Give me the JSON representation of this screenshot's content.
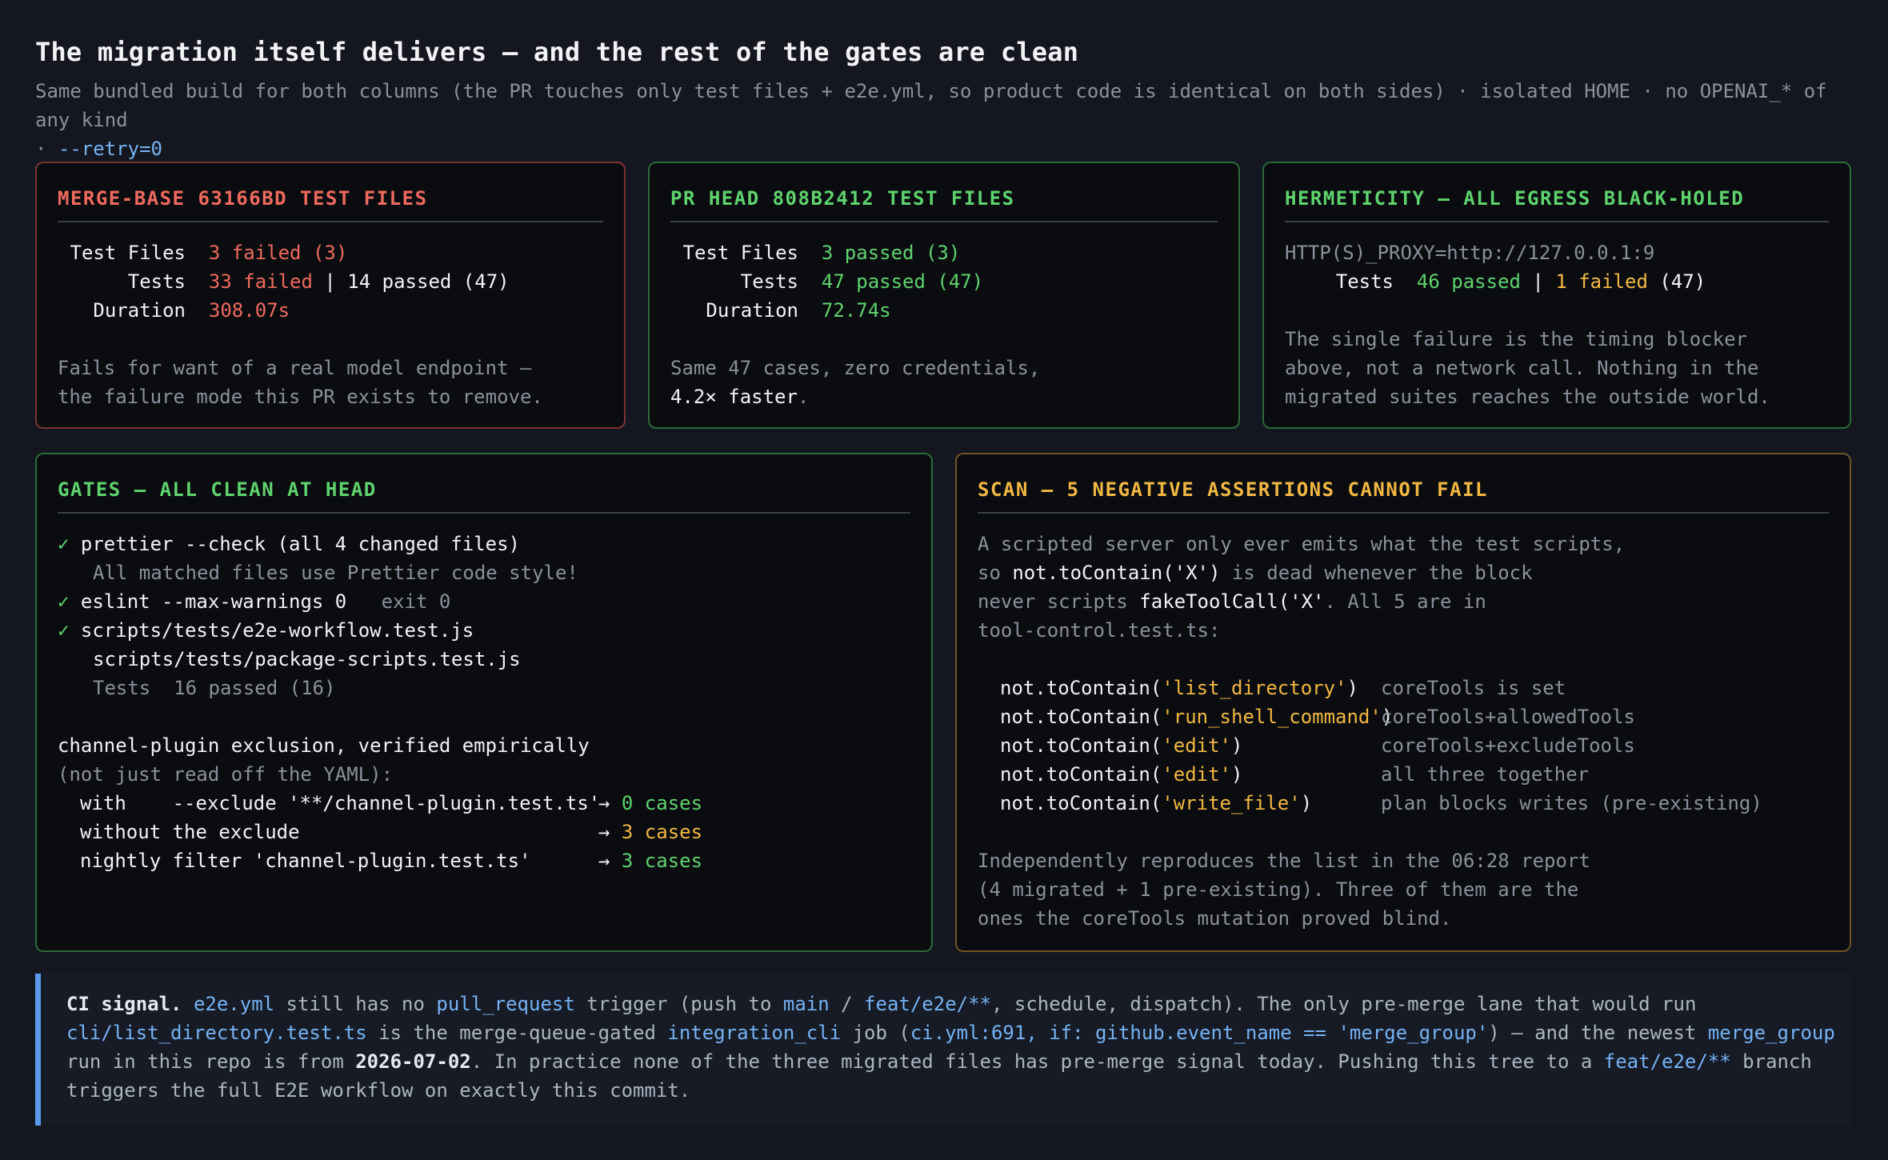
{
  "title": "The migration itself delivers — and the rest of the gates are clean",
  "subtitle": {
    "text": "Same bundled build for both columns (the PR touches only test files + e2e.yml, so product code is identical on both sides) · isolated HOME · no OPENAI_* of any kind",
    "text2_prefix": "· ",
    "retry": "--retry=0"
  },
  "merge_base": {
    "heading": "MERGE-BASE 63166BD TEST FILES",
    "k1": "Test Files",
    "v1": "3 failed (3)",
    "k2": "Tests",
    "v2a": "33 failed",
    "v2b": " | 14 passed (47)",
    "k3": "Duration",
    "v3": "308.07s",
    "note1": "Fails for want of a real model endpoint —",
    "note2": "the failure mode this PR exists to remove."
  },
  "pr_head": {
    "heading": "PR HEAD 808B2412 TEST FILES",
    "k1": "Test Files",
    "v1": "3 passed (3)",
    "k2": "Tests",
    "v2": "47 passed (47)",
    "k3": "Duration",
    "v3": "72.74s",
    "note1": "Same 47 cases, zero credentials,",
    "note2a": "4.2× faster",
    "note2b": "."
  },
  "hermeticity": {
    "heading": "HERMETICITY — ALL EGRESS BLACK-HOLED",
    "proxy": "HTTP(S)_PROXY=http://127.0.0.1:9",
    "k": "Tests",
    "va": "46 passed",
    "vb": " | ",
    "vc": "1 failed",
    "vd": " (47)",
    "note1": "The single failure is the timing blocker",
    "note2": "above, not a network call. Nothing in the",
    "note3": "migrated suites reaches the outside world."
  },
  "gates": {
    "heading": "GATES — ALL CLEAN AT HEAD",
    "check": "✓",
    "l1": "prettier --check (all 4 changed files)",
    "l2": "All matched files use Prettier code style!",
    "l3": "eslint --max-warnings 0",
    "l3b": "exit 0",
    "l4": "scripts/tests/e2e-workflow.test.js",
    "l5": "scripts/tests/package-scripts.test.js",
    "l6": "Tests  16 passed (16)",
    "e1": "channel-plugin exclusion, verified empirically",
    "e2": "(not just read off the YAML):",
    "r1": "with    --exclude '**/channel-plugin.test.ts'",
    "r1v": "0 cases",
    "r2": "without the exclude",
    "r2v": "3 cases",
    "r3": "nightly filter 'channel-plugin.test.ts'",
    "r3v": "3 cases",
    "arrow": "→"
  },
  "scan": {
    "heading": "SCAN — 5 NEGATIVE ASSERTIONS CANNOT FAIL",
    "p1": "A scripted server only ever emits what the test scripts,",
    "p2a": "so ",
    "p2b": "not.toContain('X')",
    "p2c": " is dead whenever the block",
    "p3a": "never scripts ",
    "p3b": "fakeToolCall('X'",
    "p3c": ". All 5 are in",
    "p4": "tool-control.test.ts:",
    "rows": [
      {
        "fn": "not.toContain(",
        "arg": "'list_directory'",
        "close": ")",
        "note": "coreTools is set"
      },
      {
        "fn": "not.toContain(",
        "arg": "'run_shell_command'",
        "close": ")",
        "note": "coreTools+allowedTools"
      },
      {
        "fn": "not.toContain(",
        "arg": "'edit'",
        "close": ")",
        "note": "coreTools+excludeTools"
      },
      {
        "fn": "not.toContain(",
        "arg": "'edit'",
        "close": ")",
        "note": "all three together"
      },
      {
        "fn": "not.toContain(",
        "arg": "'write_file'",
        "close": ")",
        "note": "plan blocks writes (pre-existing)"
      }
    ],
    "q1": "Independently reproduces the list in the 06:28 report",
    "q2": "(4 migrated + 1 pre-existing). Three of them are the",
    "q3": "ones the coreTools mutation proved blind."
  },
  "ci": {
    "label": "CI signal.",
    "t1": "e2e.yml",
    "t2": " still has no ",
    "t3": "pull_request",
    "t4": " trigger (push to ",
    "t5": "main",
    "t6": " / ",
    "t7": "feat/e2e/**",
    "t8": ", schedule, dispatch). The only pre-merge lane that would run",
    "t9": "cli/list_directory.test.ts",
    "t10": " is the merge-queue-gated ",
    "t11": "integration_cli",
    "t12": " job (",
    "t13": "ci.yml:691, if: github.event_name == 'merge_group'",
    "t14": ") — and the newest ",
    "t15": "merge_group",
    "t16": "run in this repo is from ",
    "t17": "2026-07-02",
    "t18": ". In practice none of the three migrated files has pre-merge signal today. Pushing this tree to a ",
    "t19": "feat/e2e/**",
    "t20": " branch",
    "t21": "triggers the full E2E workflow on exactly this commit."
  }
}
